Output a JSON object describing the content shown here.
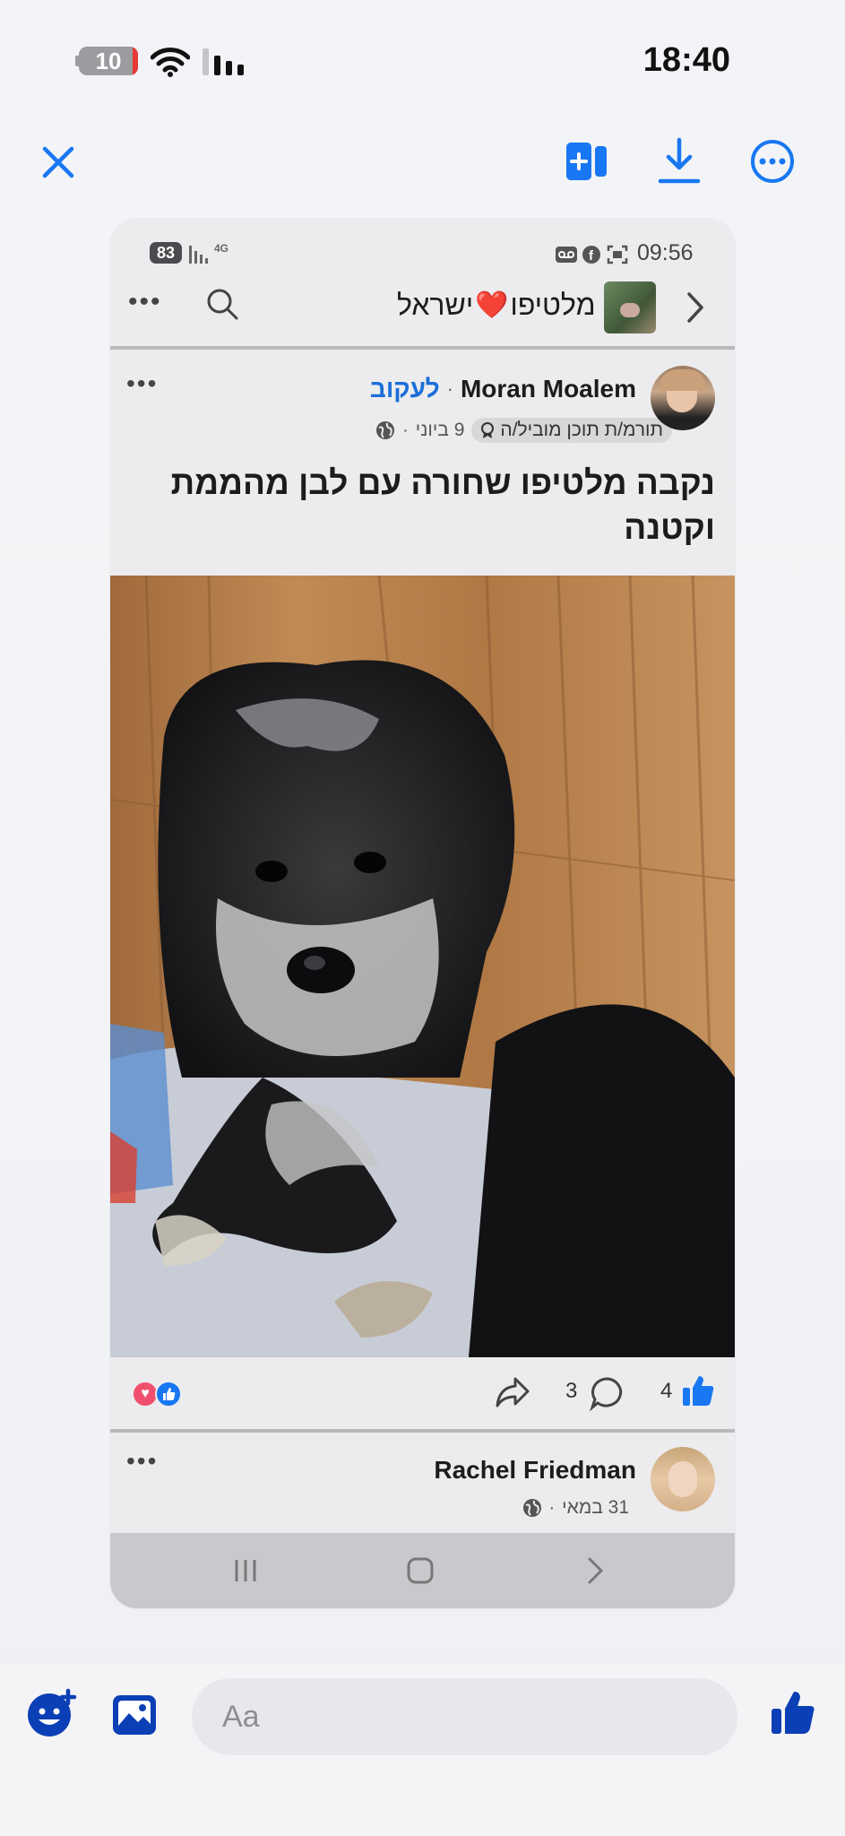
{
  "status_bar": {
    "battery": "10",
    "time": "18:40"
  },
  "toolbar": {
    "close_icon": "close-icon",
    "add_icon": "add-to-group-icon",
    "download_icon": "download-icon",
    "more_icon": "more-icon"
  },
  "shared_screenshot": {
    "status": {
      "battery": "83",
      "network": "4G",
      "time": "09:56"
    },
    "group": {
      "name_left": "מלטיפו",
      "name_right": "ישראל",
      "heart": "❤️"
    },
    "post": {
      "author": "Moran Moalem",
      "follow": "לעקוב",
      "badge": "תורמ/ת תוכן מוביל/ה",
      "date": "9 ביוני",
      "caption": "נקבה מלטיפו שחורה עם לבן מהממת וקטנה",
      "likes": "4",
      "comments": "3"
    },
    "post2": {
      "author": "Rachel Friedman",
      "date": "31 במאי"
    }
  },
  "composer": {
    "placeholder": "Aa"
  },
  "colors": {
    "accent": "#1877f2",
    "dark_accent": "#0b3fb5"
  }
}
